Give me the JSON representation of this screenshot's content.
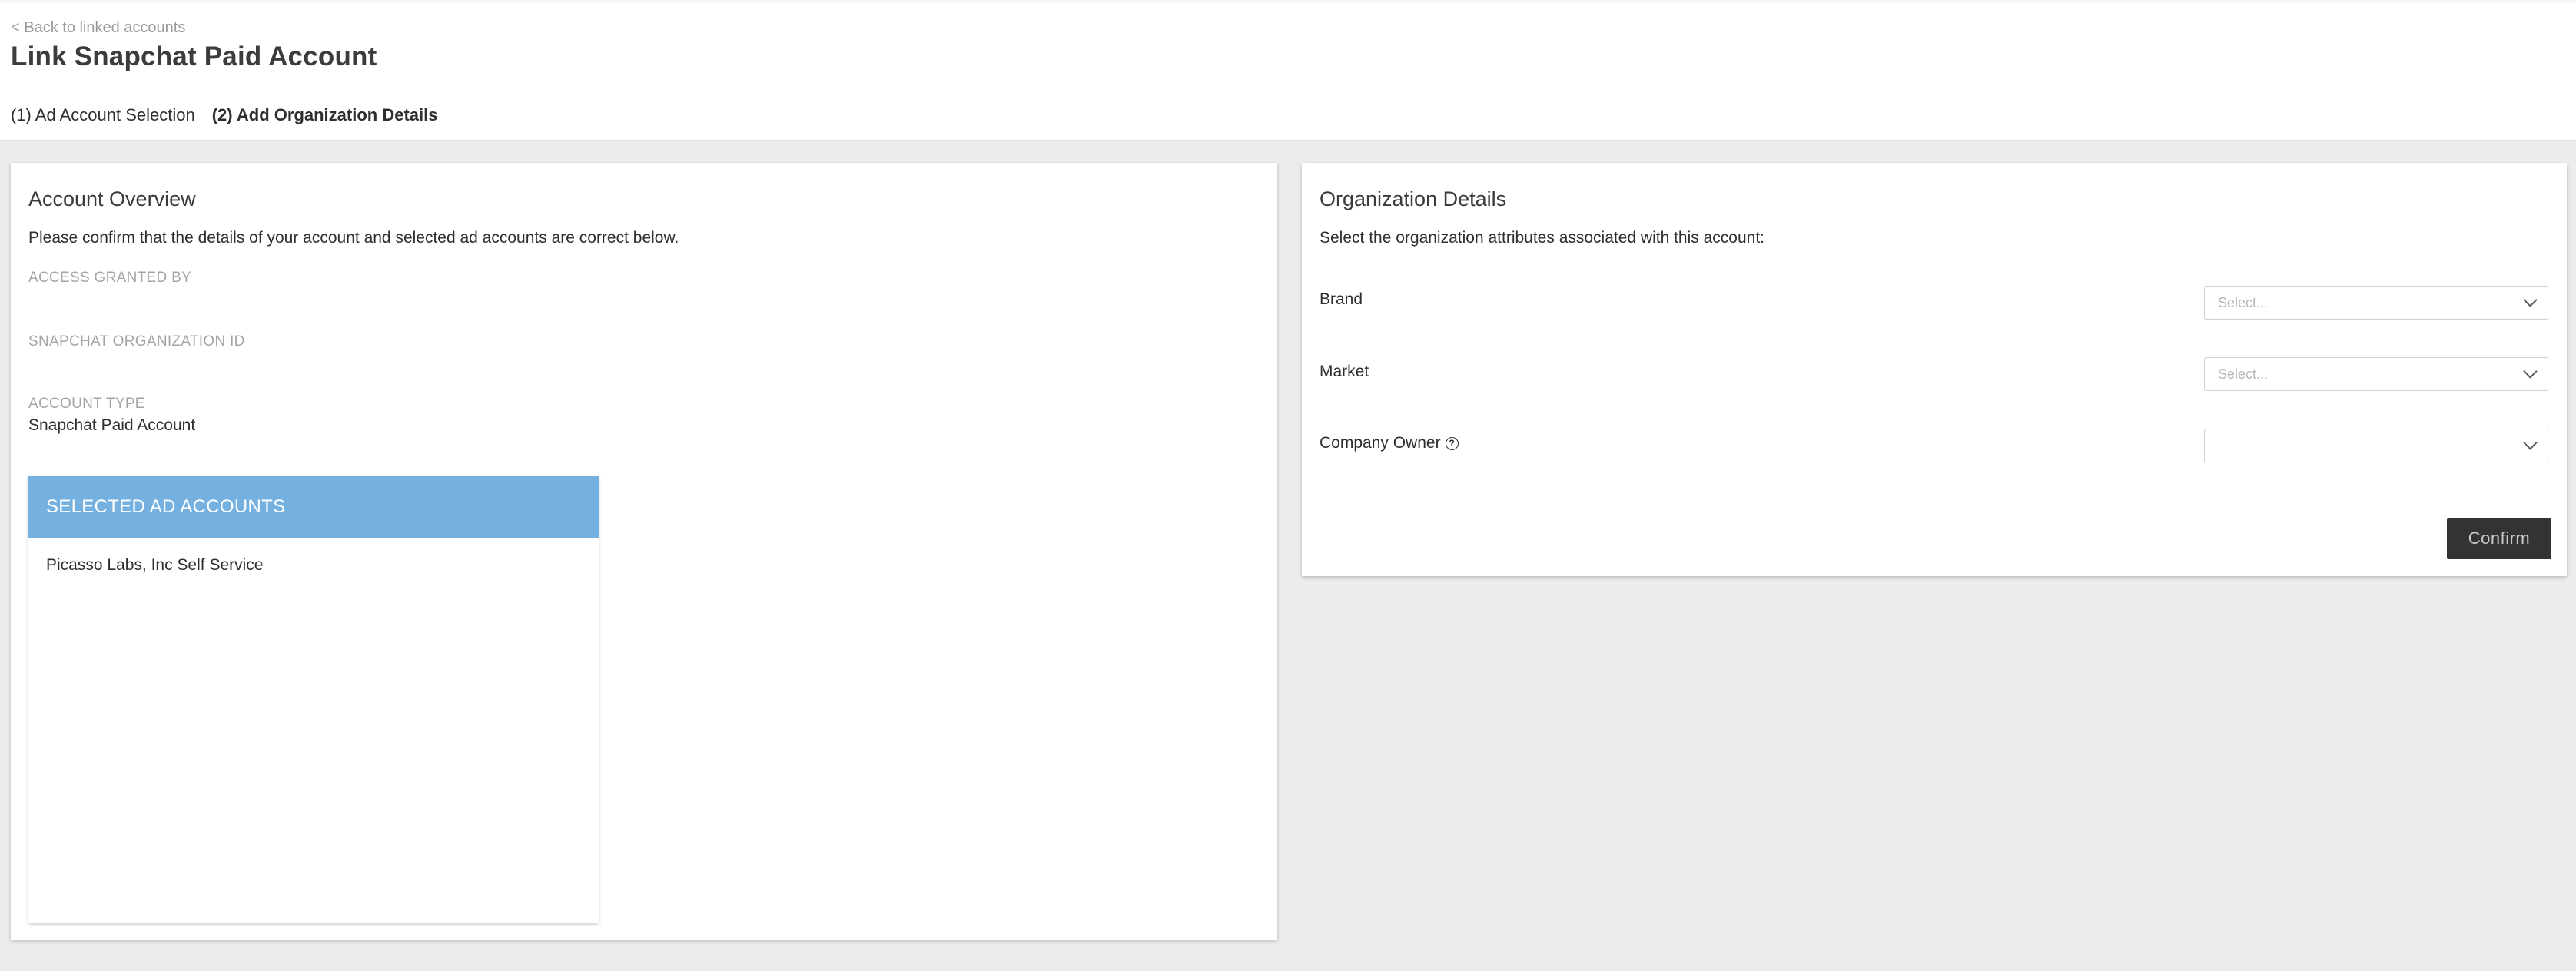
{
  "header": {
    "back_link": "< Back to linked accounts",
    "title": "Link Snapchat Paid Account",
    "steps": [
      {
        "label": "(1) Ad Account Selection",
        "active": false
      },
      {
        "label": "(2) Add Organization Details",
        "active": true
      }
    ]
  },
  "account_overview": {
    "title": "Account Overview",
    "description": "Please confirm that the details of your account and selected ad accounts are correct below.",
    "fields": [
      {
        "label": "ACCESS GRANTED BY",
        "value": ""
      },
      {
        "label": "SNAPCHAT ORGANIZATION ID",
        "value": ""
      },
      {
        "label": "ACCOUNT TYPE",
        "value": "Snapchat Paid Account"
      }
    ],
    "selected_ad_accounts": {
      "header": "SELECTED AD ACCOUNTS",
      "items": [
        "Picasso Labs, Inc Self Service"
      ]
    }
  },
  "organization_details": {
    "title": "Organization Details",
    "description": "Select the organization attributes associated with this account:",
    "fields": [
      {
        "label": "Brand",
        "placeholder": "Select...",
        "value": ""
      },
      {
        "label": "Market",
        "placeholder": "Select...",
        "value": ""
      },
      {
        "label": "Company Owner",
        "placeholder": "",
        "value": "",
        "help_icon": "question-circle-icon"
      }
    ],
    "confirm_label": "Confirm"
  },
  "colors": {
    "page_background": "#ececec",
    "selected_header": "#74b1e0",
    "confirm_button": "#333333"
  }
}
